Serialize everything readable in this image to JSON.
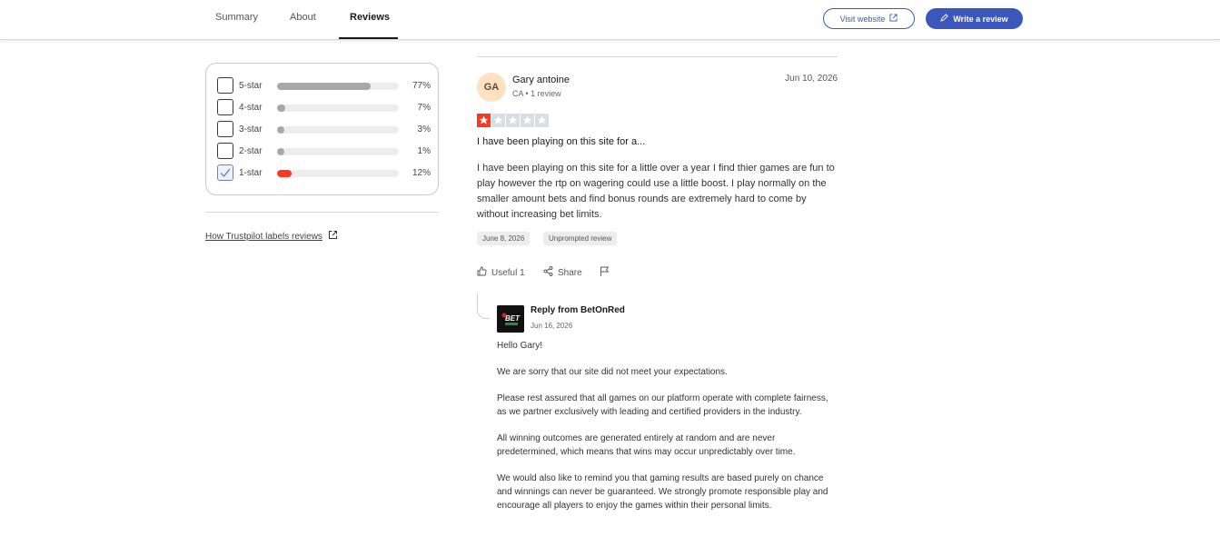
{
  "nav": {
    "tabs": [
      {
        "label": "Summary"
      },
      {
        "label": "About"
      },
      {
        "label": "Reviews"
      }
    ],
    "visit_label": "Visit website",
    "write_label": "Write a review",
    "accent": "#3c57bc"
  },
  "filters": {
    "rows": [
      {
        "label": "5-star",
        "pct": "77%",
        "fraction": 0.77,
        "checked": false,
        "bar_color": "#a8a8a8"
      },
      {
        "label": "4-star",
        "pct": "7%",
        "fraction": 0.07,
        "checked": false,
        "bar_color": "#a8a8a8"
      },
      {
        "label": "3-star",
        "pct": "3%",
        "fraction": 0.03,
        "checked": false,
        "bar_color": "#a8a8a8"
      },
      {
        "label": "2-star",
        "pct": "1%",
        "fraction": 0.01,
        "checked": false,
        "bar_color": "#a8a8a8"
      },
      {
        "label": "1-star",
        "pct": "12%",
        "fraction": 0.12,
        "checked": true,
        "bar_color": "#ff3722"
      }
    ],
    "labels_link": "How Trustpilot labels reviews"
  },
  "review": {
    "initials": "GA",
    "author": "Gary antoine",
    "meta": "CA • 1 review",
    "date": "Jun 10, 2026",
    "rating": 1,
    "title": "I have been playing on this site for a...",
    "body": "I have been playing on this site for a little over a year I find thier games are fun to play however the rtp on wagering could use a little boost. I play normally on the smaller amount bets and find bonus rounds are extremely hard to come by without increasing bet limits.",
    "experience_date": "June 8, 2026",
    "label": "Unprompted review",
    "useful_label": "Useful 1",
    "share_label": "Share"
  },
  "reply": {
    "from": "Reply from BetOnRed",
    "logo_text": "BET",
    "date": "Jun 16, 2026",
    "paragraphs": [
      "Hello Gary!",
      "We are sorry that our site did not meet your expectations.",
      "Please rest assured that all games on our platform operate with complete fairness, as we partner exclusively with leading and certified providers in the industry.",
      "All winning outcomes are generated entirely at random and are never predetermined, which means that wins may occur unpredictably over time.",
      "We would also like to remind you that gaming results are based purely on chance and winnings can never be guaranteed. We strongly promote responsible play and encourage all players to enjoy the games within their personal limits."
    ]
  }
}
